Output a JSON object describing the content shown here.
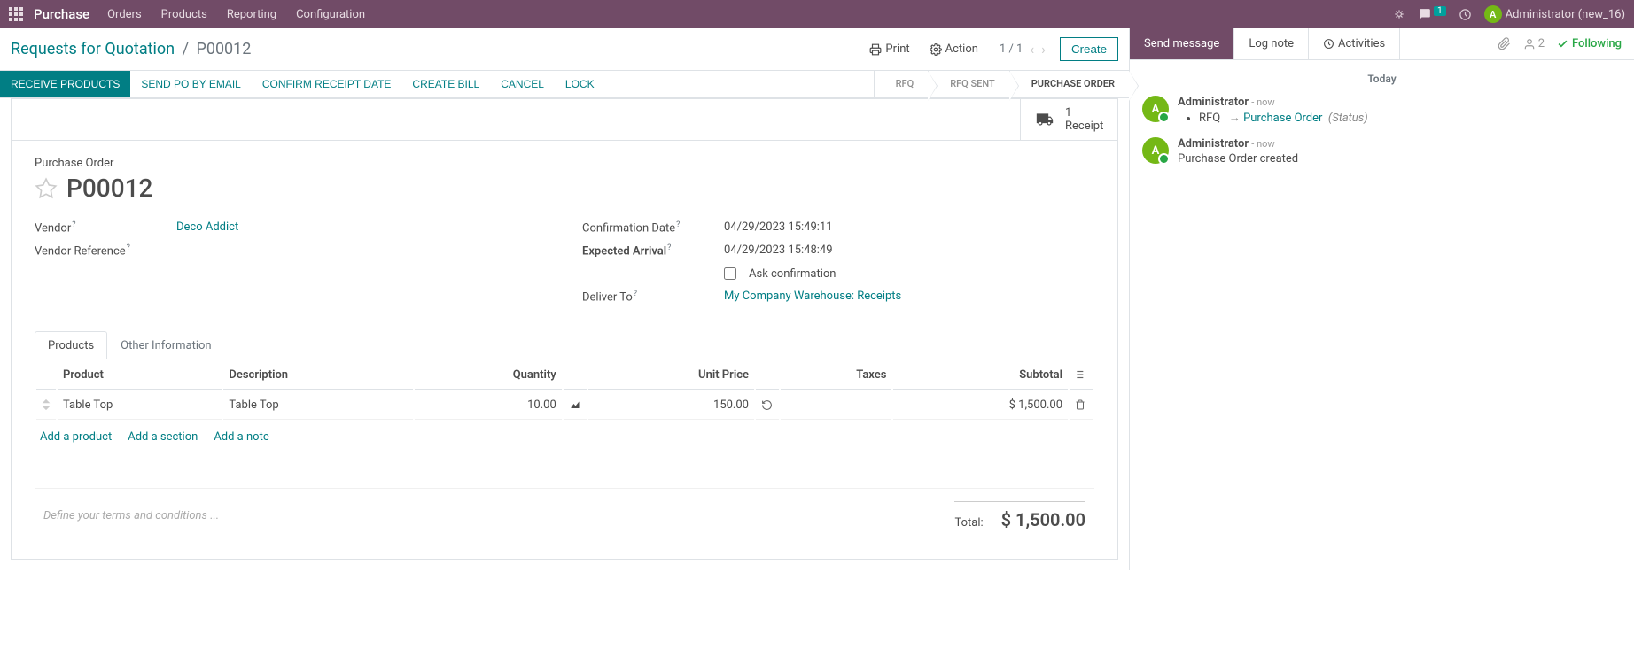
{
  "nav": {
    "brand": "Purchase",
    "menu": [
      "Orders",
      "Products",
      "Reporting",
      "Configuration"
    ],
    "chat_count": "1",
    "user_initial": "A",
    "user_name": "Administrator (new_16)"
  },
  "cp": {
    "breadcrumb_root": "Requests for Quotation",
    "breadcrumb_current": "P00012",
    "print": "Print",
    "action": "Action",
    "pager": "1 / 1",
    "create": "Create"
  },
  "statusbar": {
    "buttons": [
      "RECEIVE PRODUCTS",
      "SEND PO BY EMAIL",
      "CONFIRM RECEIPT DATE",
      "CREATE BILL",
      "CANCEL",
      "LOCK"
    ],
    "stages": [
      "RFQ",
      "RFQ SENT",
      "PURCHASE ORDER"
    ]
  },
  "stat": {
    "num": "1",
    "label": "Receipt"
  },
  "form": {
    "title_label": "Purchase Order",
    "name": "P00012",
    "fields_left": [
      {
        "label": "Vendor",
        "help": "?",
        "value": "Deco Addict",
        "link": true
      },
      {
        "label": "Vendor Reference",
        "help": "?",
        "value": "",
        "link": false
      }
    ],
    "fields_right": [
      {
        "label": "Confirmation Date",
        "help": "?",
        "value": "04/29/2023 15:49:11"
      },
      {
        "label": "Expected Arrival",
        "help": "?",
        "value": "04/29/2023 15:48:49"
      },
      {
        "label": "",
        "checkbox": true,
        "chklabel": "Ask confirmation"
      },
      {
        "label": "Deliver To",
        "help": "?",
        "value": "My Company Warehouse: Receipts",
        "link": true
      }
    ],
    "tabs": [
      "Products",
      "Other Information"
    ],
    "table": {
      "headers": [
        "Product",
        "Description",
        "Quantity",
        "Unit Price",
        "Taxes",
        "Subtotal"
      ],
      "rows": [
        {
          "product": "Table Top",
          "description": "Table Top",
          "quantity": "10.00",
          "unit_price": "150.00",
          "taxes": "",
          "subtotal": "$ 1,500.00"
        }
      ],
      "add_product": "Add a product",
      "add_section": "Add a section",
      "add_note": "Add a note"
    },
    "terms_placeholder": "Define your terms and conditions ...",
    "total_label": "Total:",
    "total_value": "$ 1,500.00"
  },
  "chatter": {
    "send": "Send message",
    "log": "Log note",
    "activities": "Activities",
    "followers": "2",
    "following": "Following",
    "date": "Today",
    "messages": [
      {
        "author": "Administrator",
        "initial": "A",
        "time": "now",
        "tracking": {
          "field": "RFQ",
          "arrow": "→",
          "new": "Purchase Order",
          "status": "(Status)"
        }
      },
      {
        "author": "Administrator",
        "initial": "A",
        "time": "now",
        "text": "Purchase Order created"
      }
    ]
  }
}
